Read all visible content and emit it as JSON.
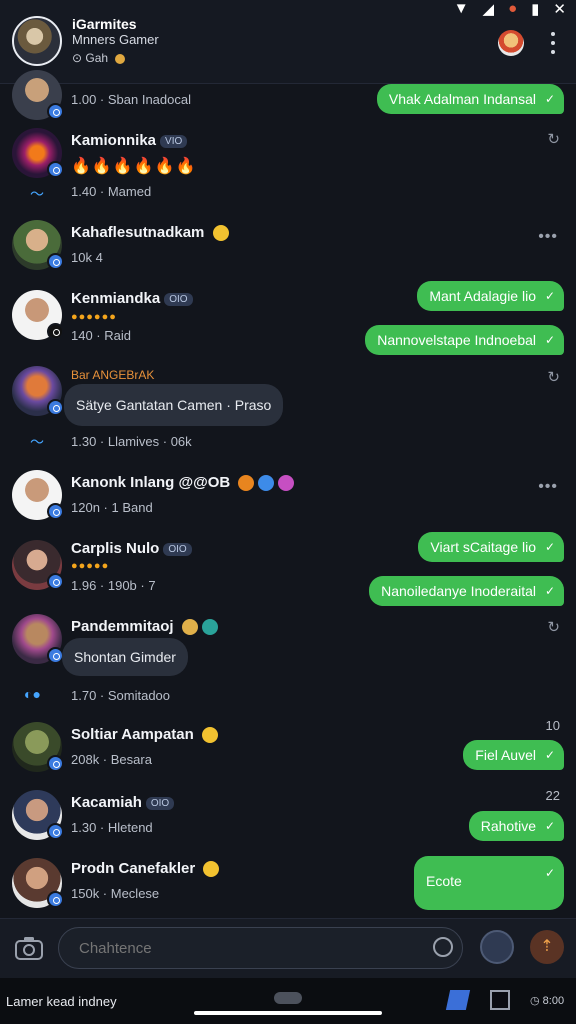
{
  "header": {
    "title": "iGarmites",
    "subtitle": "Mnners Gamer",
    "status": "Gah",
    "status_suffix": "⊙"
  },
  "rows": [
    {
      "meta": "1.00 · Sban Inadocal",
      "bubble": "Vhak Adalman Indansal"
    },
    {
      "name": "Kamionnika",
      "tag": "VIO",
      "meta": "1.40 · Mamed"
    },
    {
      "name": "Kahaflesutnadkam",
      "meta": "10k 4"
    },
    {
      "name": "Kenmiandka",
      "tag": "OIO",
      "meta": "140 · Raid",
      "bubble1": "Mant Adalagie lio",
      "bubble2": "Nannovelstape Indnoebal"
    },
    {
      "orange": "Bar ANGEBrAK",
      "bubble_in": "Sätye Gantatan Camen · Praso",
      "meta": "1.30 · Llamives · 06k"
    },
    {
      "name": "Kanonk Inlang @@OB",
      "meta": "120n · 1 Band"
    },
    {
      "name": "Carplis Nulo",
      "tag": "OIO",
      "meta": "1.96 · 190b · 7",
      "bubble1": "Viart sCaitage lio",
      "bubble2": "Nanoiledanye Inoderaital"
    },
    {
      "name": "Pandemmitaoj",
      "bubble_in": "Shontan Gimder",
      "meta": "1.70 · Somitadoo"
    },
    {
      "name": "Soltiar Aampatan",
      "meta": "208k · Besara",
      "time": "10",
      "bubble": "Fiel Auvel"
    },
    {
      "name": "Kacamiah",
      "tag": "OIO",
      "meta": "1.30 · Hletend",
      "time": "22",
      "bubble": "Rahotive"
    },
    {
      "name": "Prodn Canefakler",
      "meta": "150k · Meclese",
      "bubble": "Ecote"
    }
  ],
  "composer": {
    "placeholder": "Chahtence"
  },
  "navbar": {
    "text": "Lamer kead indney",
    "time": "8:00"
  },
  "colors": {
    "accent_green": "#3fbd52",
    "badge_blue": "#3b7be0",
    "background": "#12151c"
  },
  "icons": [
    "camera-icon",
    "sticker-icon",
    "send-icon",
    "kebab-menu-icon",
    "check-icon",
    "retry-icon"
  ]
}
